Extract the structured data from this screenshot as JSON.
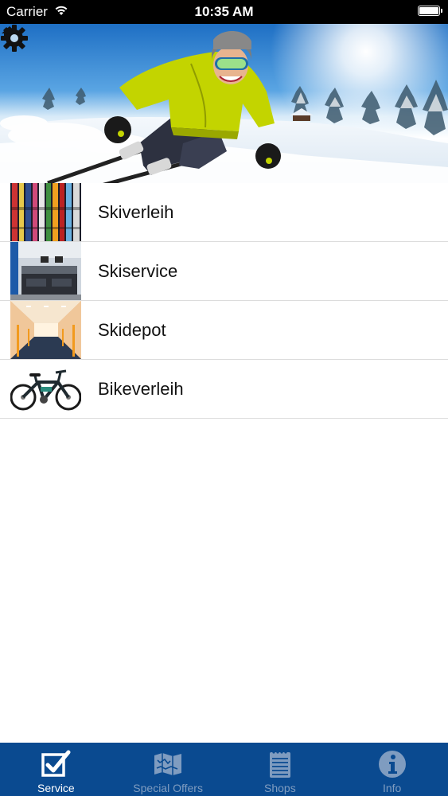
{
  "status_bar": {
    "carrier": "Carrier",
    "time": "10:35 AM"
  },
  "hero": {
    "home_icon": "home-icon",
    "settings_icon": "gear-icon"
  },
  "service_list": {
    "items": [
      {
        "label": "Skiverleih",
        "icon": "skis-thumbnail"
      },
      {
        "label": "Skiservice",
        "icon": "workshop-thumbnail"
      },
      {
        "label": "Skidepot",
        "icon": "depot-thumbnail"
      },
      {
        "label": "Bikeverleih",
        "icon": "ebike-thumbnail"
      }
    ]
  },
  "tab_bar": {
    "tabs": [
      {
        "label": "Service",
        "icon": "checkbox-icon",
        "active": true
      },
      {
        "label": "Special Offers",
        "icon": "map-icon",
        "active": false
      },
      {
        "label": "Shops",
        "icon": "notepad-icon",
        "active": false
      },
      {
        "label": "Info",
        "icon": "info-icon",
        "active": false
      }
    ]
  },
  "colors": {
    "tab_bar_bg": "#0a4a90",
    "tab_active": "#ffffff",
    "tab_inactive": "#7f9cc0",
    "status_bar_bg": "#000000"
  }
}
